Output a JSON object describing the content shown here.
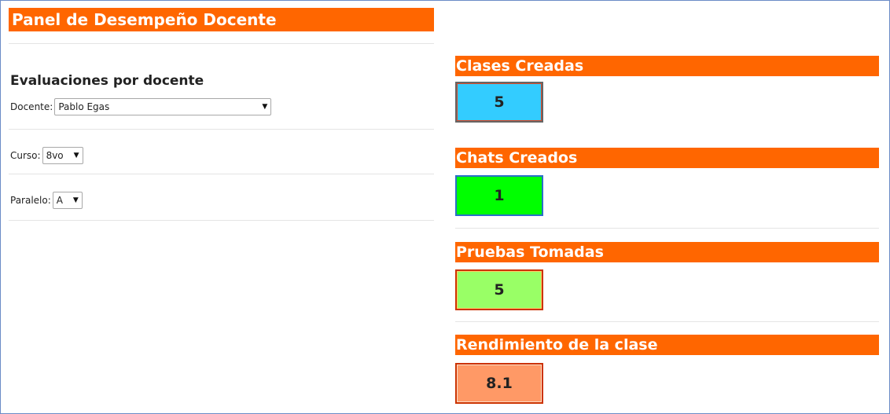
{
  "panel": {
    "title": "Panel de Desempeño Docente"
  },
  "filters": {
    "section_title": "Evaluaciones por docente",
    "docente": {
      "label": "Docente:",
      "value": "Pablo Egas"
    },
    "curso": {
      "label": "Curso:",
      "value": "8vo"
    },
    "paralelo": {
      "label": "Paralelo:",
      "value": "A"
    }
  },
  "stats": {
    "clases": {
      "label": "Clases Creadas",
      "value": "5",
      "color": "#33ccff"
    },
    "chats": {
      "label": "Chats Creados",
      "value": "1",
      "color": "#00ff00"
    },
    "pruebas": {
      "label": "Pruebas Tomadas",
      "value": "5",
      "color": "#99ff66"
    },
    "rendimiento": {
      "label": "Rendimiento de la clase",
      "value": "8.1",
      "color": "#ff9966"
    }
  },
  "colors": {
    "header": "#ff6600",
    "frame_border": "#6b8bc7"
  },
  "icons": {
    "dropdown": "chevron-down-icon"
  }
}
